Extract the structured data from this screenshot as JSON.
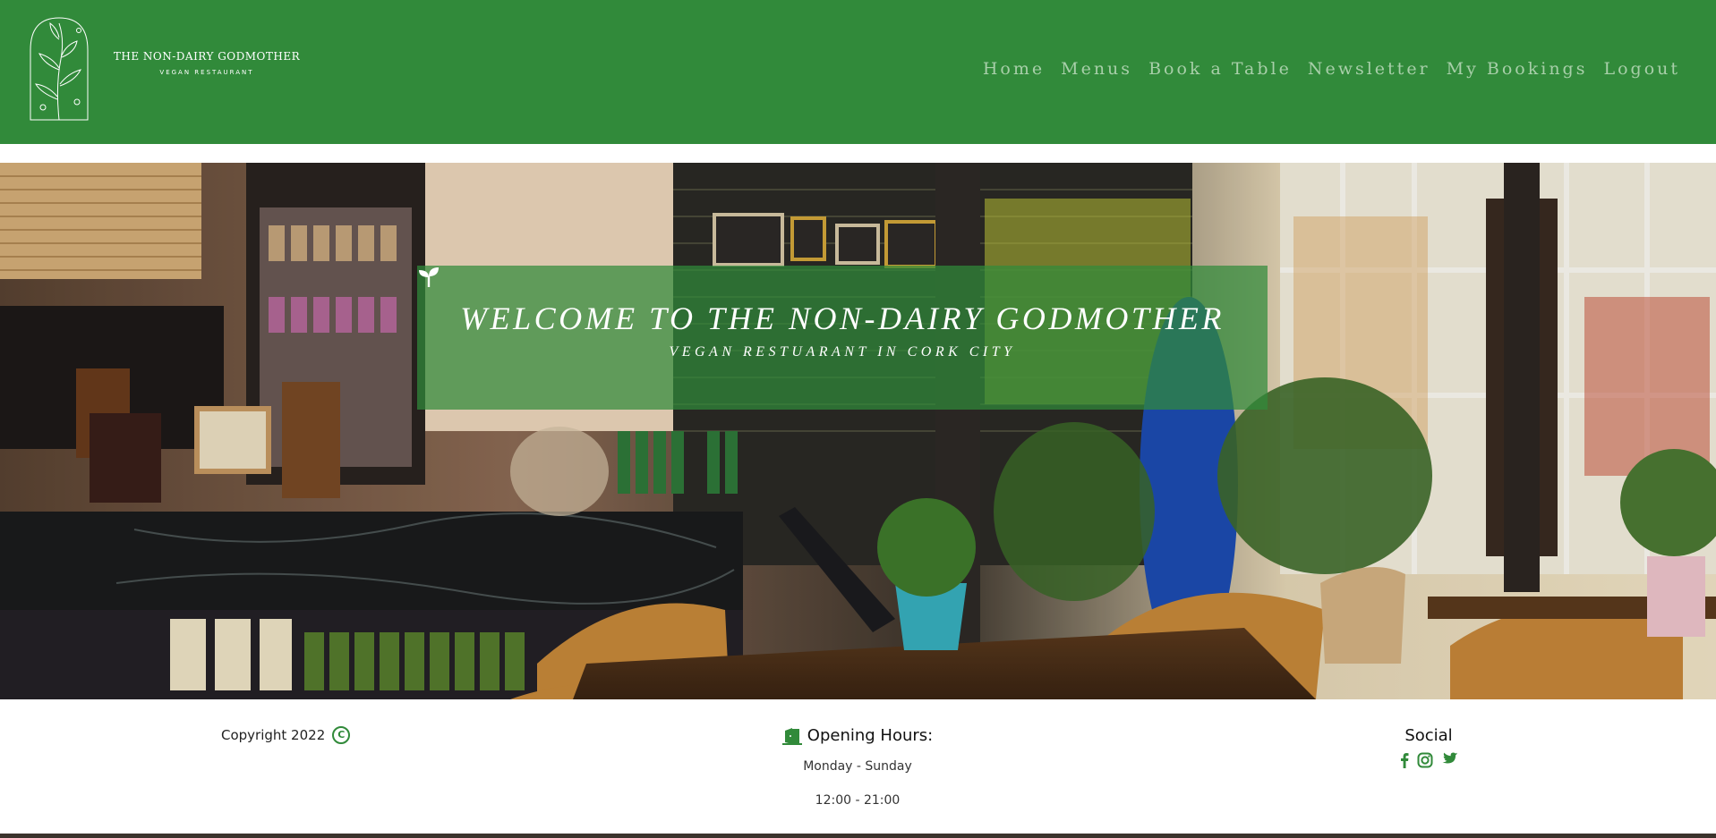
{
  "brand": {
    "name": "THE NON-DAIRY GODMOTHER",
    "tagline": "VEGAN RESTAURANT",
    "logo_icon": "botanical-leaf-icon"
  },
  "nav": {
    "items": [
      {
        "label": "Home"
      },
      {
        "label": "Menus"
      },
      {
        "label": "Book a Table"
      },
      {
        "label": "Newsletter"
      },
      {
        "label": "My Bookings"
      },
      {
        "label": "Logout"
      }
    ]
  },
  "hero": {
    "title": "WELCOME TO THE NON-DAIRY GODMOTHER",
    "subtitle": "VEGAN RESTUARANT IN CORK CITY",
    "icon": "sprout-icon",
    "background": "cafe-interior-photo"
  },
  "footer": {
    "copyright": "Copyright 2022",
    "copyright_icon": "copyright-icon",
    "hours_heading": "Opening Hours:",
    "hours_icon": "door-open-icon",
    "hours_days": "Monday - Sunday",
    "hours_time": "12:00 - 21:00",
    "social_heading": "Social",
    "social_icons": [
      "facebook-icon",
      "instagram-icon",
      "twitter-icon"
    ]
  },
  "colors": {
    "brand_green": "#318a3a",
    "nav_text": "#a8cfa9",
    "banner_overlay": "rgba(48, 138, 58, 0.72)"
  }
}
